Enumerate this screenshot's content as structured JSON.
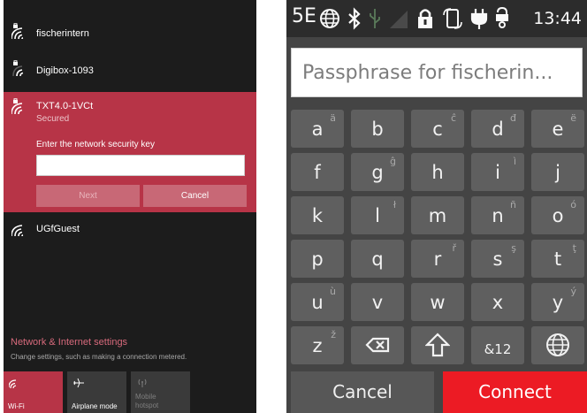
{
  "windows_flyout": {
    "networks": [
      {
        "name": "fischerintern",
        "secured": true
      },
      {
        "name": "Digibox-1093",
        "secured": true
      },
      {
        "name": "TXT4.0-1VCt",
        "secured": true,
        "status": "Secured",
        "key_prompt": "Enter the network security key",
        "next_label": "Next",
        "cancel_label": "Cancel"
      },
      {
        "name": "UGfGuest",
        "secured": false
      }
    ],
    "settings": {
      "title": "Network & Internet settings",
      "description": "Change settings, such as making a connection metered."
    },
    "quick_actions": [
      {
        "label": "Wi-Fi",
        "icon": "wifi-icon",
        "active": true
      },
      {
        "label": "Airplane mode",
        "icon": "airplane-icon",
        "active": false
      },
      {
        "label": "Mobile hotspot",
        "label_lines": [
          "Mobile",
          "hotspot"
        ],
        "icon": "hotspot-icon",
        "active": false
      }
    ],
    "colors": {
      "accent": "#b73447",
      "background": "#1c1c1c",
      "link": "#d76a7c"
    }
  },
  "android": {
    "status_bar": {
      "time": "13:44",
      "left_icon": "5E",
      "icons": [
        "globe-icon",
        "bluetooth-icon",
        "usb-icon",
        "signal-icon",
        "lock-icon",
        "screen-rotate-icon",
        "power-plug-icon",
        "person-lock-icon"
      ]
    },
    "passphrase_placeholder": "Passphrase for fischerin...",
    "keyboard_rows": [
      [
        {
          "main": "a",
          "alt": "ä"
        },
        {
          "main": "b",
          "alt": ""
        },
        {
          "main": "c",
          "alt": "ĉ"
        },
        {
          "main": "d",
          "alt": "đ"
        },
        {
          "main": "e",
          "alt": "ë"
        }
      ],
      [
        {
          "main": "f",
          "alt": ""
        },
        {
          "main": "g",
          "alt": "ĝ"
        },
        {
          "main": "h",
          "alt": ""
        },
        {
          "main": "i",
          "alt": "ì"
        },
        {
          "main": "j",
          "alt": ""
        }
      ],
      [
        {
          "main": "k",
          "alt": ""
        },
        {
          "main": "l",
          "alt": "ł"
        },
        {
          "main": "m",
          "alt": ""
        },
        {
          "main": "n",
          "alt": "ñ"
        },
        {
          "main": "o",
          "alt": "ó"
        }
      ],
      [
        {
          "main": "p",
          "alt": ""
        },
        {
          "main": "q",
          "alt": ""
        },
        {
          "main": "r",
          "alt": "ř"
        },
        {
          "main": "s",
          "alt": "ş"
        },
        {
          "main": "t",
          "alt": "ţ"
        }
      ],
      [
        {
          "main": "u",
          "alt": "ù"
        },
        {
          "main": "v",
          "alt": ""
        },
        {
          "main": "w",
          "alt": ""
        },
        {
          "main": "x",
          "alt": ""
        },
        {
          "main": "y",
          "alt": "ý"
        }
      ],
      [
        {
          "main": "z",
          "alt": "ž"
        },
        {
          "icon": "backspace-icon"
        },
        {
          "icon": "shift-icon"
        },
        {
          "main": "&12",
          "alt": ""
        },
        {
          "icon": "globe-icon"
        }
      ]
    ],
    "cancel_label": "Cancel",
    "connect_label": "Connect",
    "colors": {
      "connect": "#ec1b24",
      "key": "#5f5f5f",
      "background": "#444444"
    }
  }
}
